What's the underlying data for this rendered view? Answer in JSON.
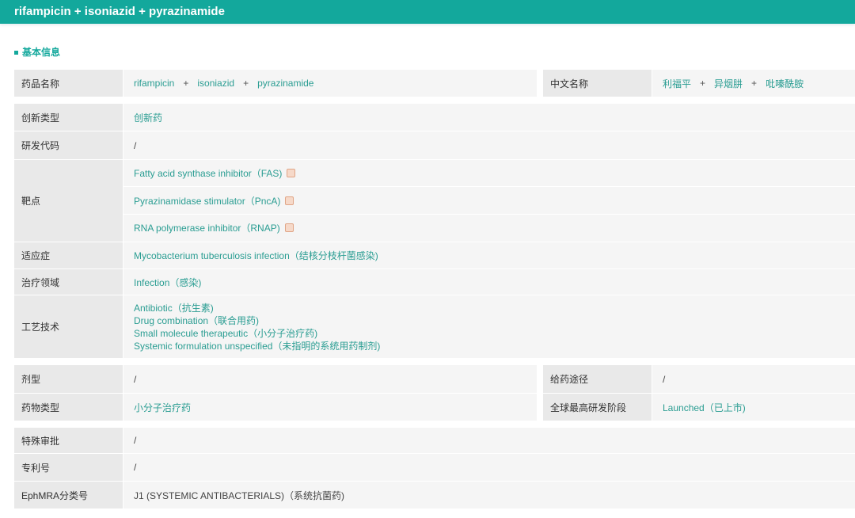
{
  "title": "rifampicin + isoniazid + pyrazinamide",
  "section": "基本信息",
  "name_row": {
    "label": "药品名称",
    "parts": [
      "rifampicin",
      "isoniazid",
      "pyrazinamide"
    ],
    "cn_label": "中文名称",
    "cn_parts": [
      "利福平",
      "异烟肼",
      "吡嗪酰胺"
    ],
    "plus": "+"
  },
  "rows": {
    "innovation": {
      "label": "创新类型",
      "value": "创新药"
    },
    "code": {
      "label": "研发代码",
      "value": "/"
    },
    "target": {
      "label": "靶点",
      "values": [
        "Fatty acid synthase inhibitor（FAS)",
        "Pyrazinamidase stimulator（PncA)",
        "RNA polymerase inhibitor（RNAP)"
      ]
    },
    "indication": {
      "label": "适应症",
      "value": "Mycobacterium tuberculosis infection（结核分枝杆菌感染)"
    },
    "area": {
      "label": "治疗领域",
      "value": "Infection（感染)"
    },
    "tech": {
      "label": "工艺技术",
      "values": [
        "Antibiotic（抗生素)",
        "Drug combination（联合用药)",
        "Small molecule therapeutic（小分子治疗药)",
        "Systemic formulation unspecified（未指明的系统用药制剂)"
      ]
    }
  },
  "form_row": {
    "label": "剂型",
    "value": "/",
    "label2": "给药途径",
    "value2": "/"
  },
  "type_row": {
    "label": "药物类型",
    "value": "小分子治疗药",
    "label2": "全球最高研发阶段",
    "value2": "Launched（已上市)"
  },
  "rows2": {
    "approval": {
      "label": "特殊审批",
      "value": "/"
    },
    "patent": {
      "label": "专利号",
      "value": "/"
    },
    "ephmra": {
      "label": "EphMRA分类号",
      "value": "J1 (SYSTEMIC ANTIBACTERIALS)（系统抗菌药)"
    }
  }
}
